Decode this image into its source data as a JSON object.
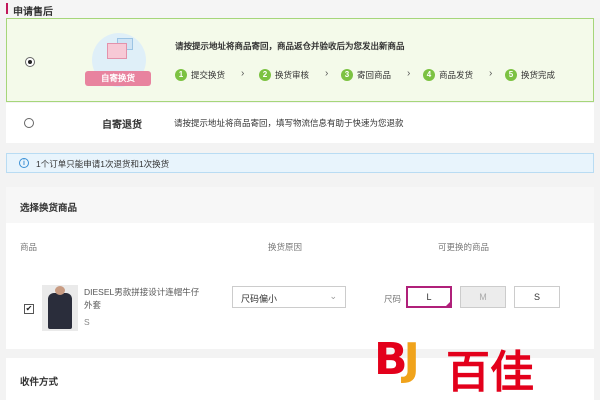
{
  "header": {
    "title": "申请售后"
  },
  "option_exchange": {
    "selected": true,
    "badge_text": "自寄换货",
    "description": "请按提示地址将商品寄回，商品返仓并验收后为您发出新商品",
    "steps": [
      {
        "num": "1",
        "label": "提交换货"
      },
      {
        "num": "2",
        "label": "换货审核"
      },
      {
        "num": "3",
        "label": "寄回商品"
      },
      {
        "num": "4",
        "label": "商品发货"
      },
      {
        "num": "5",
        "label": "换货完成"
      }
    ],
    "step_color": "#7cc242"
  },
  "option_return": {
    "selected": false,
    "name": "自寄退货",
    "description": "请按提示地址将商品寄回，填写物流信息有助于快速为您退款"
  },
  "notice": {
    "icon": "info-icon",
    "text": "1个订单只能申请1次退货和1次换货"
  },
  "exchange_section": {
    "title": "选择换货商品",
    "columns": {
      "product": "商品",
      "reason": "换货原因",
      "options": "可更换的商品"
    },
    "item": {
      "checked": true,
      "name": "DIESEL男款拼接设计连帽牛仔外套",
      "size": "S",
      "reason": "尺码偏小",
      "size_label": "尺码",
      "sizes": [
        {
          "label": "L",
          "state": "selected"
        },
        {
          "label": "M",
          "state": "disabled"
        },
        {
          "label": "S",
          "state": "available"
        }
      ]
    }
  },
  "shipping_section": {
    "title": "收件方式"
  },
  "colors": {
    "accent": "#b0207a",
    "header_bar": "#c2185b",
    "selected_border": "#a6d67a",
    "watermark_red": "#e3001b",
    "watermark_orange": "#f0a31b"
  },
  "watermark": {
    "logo": "BJ",
    "text": "百佳"
  }
}
